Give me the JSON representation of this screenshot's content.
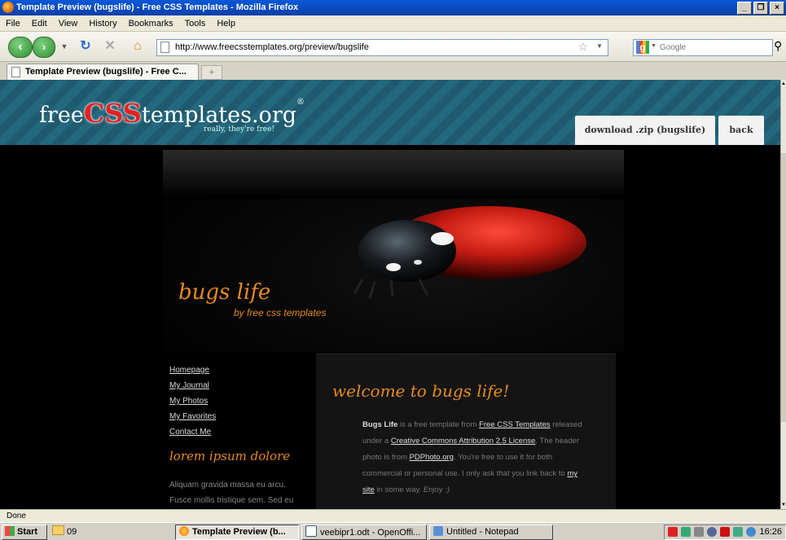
{
  "window": {
    "title": "Template Preview (bugslife) - Free CSS Templates - Mozilla Firefox",
    "controls": [
      "_",
      "❐",
      "×"
    ]
  },
  "menu": [
    "File",
    "Edit",
    "View",
    "History",
    "Bookmarks",
    "Tools",
    "Help"
  ],
  "toolbar": {
    "url": "http://www.freecsstemplates.org/preview/bugslife",
    "search_placeholder": "Google"
  },
  "tabs": [
    {
      "label": "Template Preview (bugslife) - Free C...",
      "active": true
    }
  ],
  "site": {
    "logo_free": "free",
    "logo_css": "CSS",
    "logo_templates": "templates.org",
    "logo_reg": "®",
    "tagline": "really, they're free!",
    "download_label": "download .zip (bugslife)",
    "back_label": "back",
    "title": "bugs life",
    "subtitle": "by free css templates",
    "nav": [
      "Homepage",
      "My Journal",
      "My Photos",
      "My Favorites",
      "Contact Me"
    ],
    "side_heading": "lorem ipsum dolore",
    "side_text": "Aliquam gravida massa eu arcu. Fusce mollis tristique sem. Sed eu",
    "welcome": "welcome to bugs life!",
    "content": {
      "p1_bold": "Bugs Life",
      "p1_a": " is a free template from ",
      "link1": "Free CSS Templates",
      "p1_b": " released under a ",
      "link2": "Creative Commons Attribution 2.5 License",
      "p1_c": ". The header photo is from ",
      "link3": "PDPhoto.org",
      "p1_d": ". You're free to use it for both commercial or personal use. I only ask that you link back to ",
      "link4": "my site",
      "p1_e": " in some way. ",
      "enjoy": "Enjoy :)"
    }
  },
  "status": "Done",
  "taskbar": {
    "start": "Start",
    "quick_folder": "09",
    "tasks": [
      {
        "label": "Template Preview (b...",
        "active": true
      },
      {
        "label": "veebipr1.odt - OpenOffi...",
        "active": false
      },
      {
        "label": "Untitled - Notepad",
        "active": false
      }
    ],
    "clock": "16:26"
  }
}
